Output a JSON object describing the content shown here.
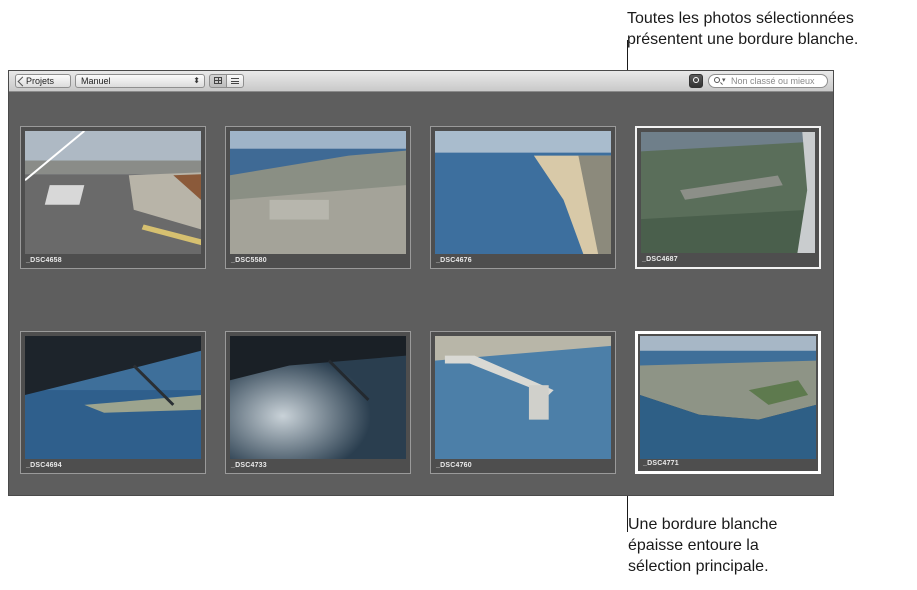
{
  "callouts": {
    "top": {
      "line1": "Toutes les photos sélectionnées",
      "line2": "présentent une bordure blanche."
    },
    "bottom": {
      "line1": "Une bordure blanche",
      "line2": "épaisse entoure la",
      "line3": "sélection principale."
    }
  },
  "toolbar": {
    "projects_label": "Projets",
    "sort_value": "Manuel",
    "search_placeholder": "Non classé ou mieux"
  },
  "photos": [
    {
      "name": "_DSC4658",
      "selected": false
    },
    {
      "name": "_DSC5580",
      "selected": false
    },
    {
      "name": "_DSC4676",
      "selected": false
    },
    {
      "name": "_DSC4687",
      "selected": true
    },
    {
      "name": "_DSC4694",
      "selected": false
    },
    {
      "name": "_DSC4733",
      "selected": false
    },
    {
      "name": "_DSC4760",
      "selected": false
    },
    {
      "name": "_DSC4771",
      "selected": true,
      "primary": true
    }
  ],
  "icons": {
    "back": "chevron-left-icon",
    "sort": "updown-arrows-icon",
    "grid_view": "grid-view-icon",
    "list_view": "list-view-icon",
    "filter": "filter-icon",
    "search": "search-icon"
  },
  "colors": {
    "browser_bg": "#5e5e5e",
    "selection_border": "#ffffff"
  }
}
